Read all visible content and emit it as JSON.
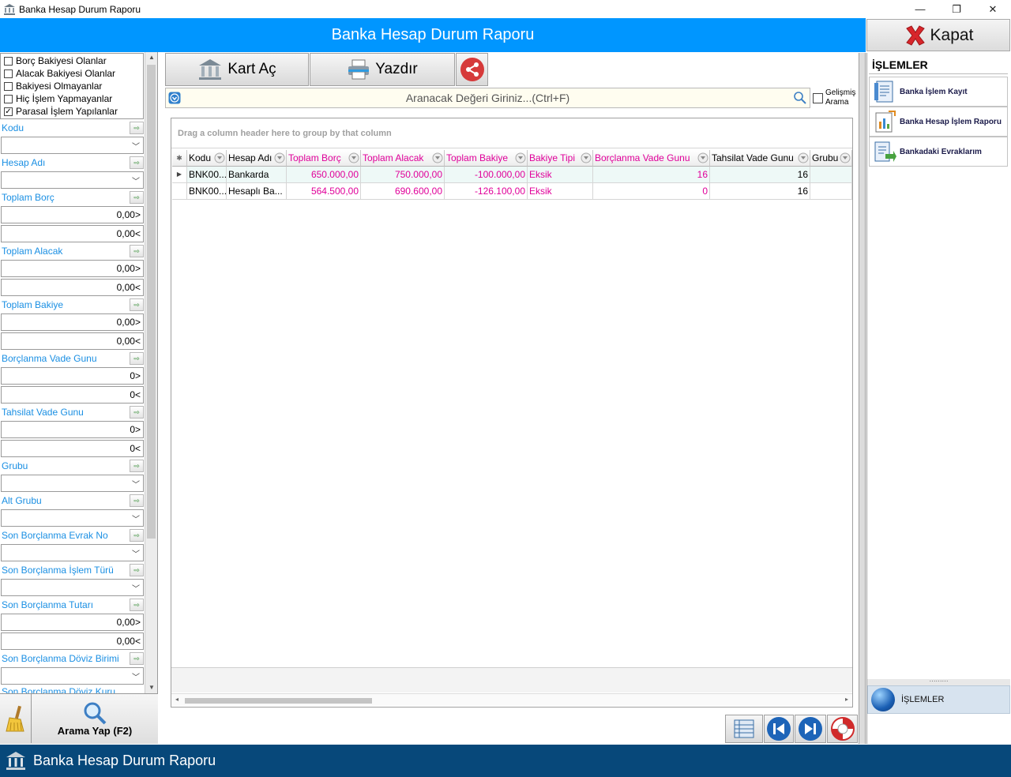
{
  "window": {
    "title": "Banka Hesap Durum Raporu",
    "controls": [
      "—",
      "❐",
      "✕"
    ]
  },
  "header": {
    "title": "Banka Hesap Durum Raporu",
    "close_label": "Kapat"
  },
  "filters": {
    "checkboxes": [
      {
        "label": "Borç Bakiyesi Olanlar",
        "checked": false
      },
      {
        "label": "Alacak Bakiyesi Olanlar",
        "checked": false
      },
      {
        "label": "Bakiyesi Olmayanlar",
        "checked": false
      },
      {
        "label": "Hiç İşlem Yapmayanlar",
        "checked": false
      },
      {
        "label": "Parasal İşlem Yapılanlar",
        "checked": true
      }
    ],
    "fields": {
      "kodu": "Kodu",
      "hesap_adi": "Hesap Adı",
      "toplam_borc": "Toplam Borç",
      "toplam_alacak": "Toplam Alacak",
      "toplam_bakiye": "Toplam Bakiye",
      "borclanma_vade_gunu": "Borçlanma Vade Gunu",
      "tahsilat_vade_gunu": "Tahsilat Vade Gunu",
      "grubu": "Grubu",
      "alt_grubu": "Alt Grubu",
      "son_borclanma_evrak_no": "Son Borçlanma Evrak No",
      "son_borclanma_islem_turu": "Son Borçlanma İşlem Türü",
      "son_borclanma_tutari": "Son Borçlanma Tutarı",
      "son_borclanma_doviz_birimi": "Son Borçlanma Döviz Birimi",
      "son_borclanma_doviz_kuru": "Son Borçlanma Döviz Kuru"
    },
    "values": {
      "toplam_borc_min": "0,00>",
      "toplam_borc_max": "0,00<",
      "toplam_alacak_min": "0,00>",
      "toplam_alacak_max": "0,00<",
      "toplam_bakiye_min": "0,00>",
      "toplam_bakiye_max": "0,00<",
      "borc_vade_min": "0>",
      "borc_vade_max": "0<",
      "tahsilat_vade_min": "0>",
      "tahsilat_vade_max": "0<",
      "son_tutar_min": "0,00>",
      "son_tutar_max": "0,00<"
    },
    "search_button": "Arama Yap (F2)"
  },
  "toolbar": {
    "kart_ac": "Kart Aç",
    "yazdir": "Yazdır"
  },
  "search": {
    "placeholder": "Aranacak Değeri Giriniz...(Ctrl+F)",
    "advanced_label_1": "Gelişmiş",
    "advanced_label_2": "Arama"
  },
  "grid": {
    "group_hint": "Drag a column header here to group by that column",
    "columns": [
      "Kodu",
      "Hesap Adı",
      "Toplam Borç",
      "Toplam Alacak",
      "Toplam Bakiye",
      "Bakiye Tipi",
      "Borçlanma Vade Gunu",
      "Tahsilat Vade Gunu",
      "Grubu"
    ],
    "rows": [
      {
        "kodu": "BNK00...",
        "hesap_adi": "Bankarda",
        "toplam_borc": "650.000,00",
        "toplam_alacak": "750.000,00",
        "toplam_bakiye": "-100.000,00",
        "bakiye_tipi": "Eksik",
        "borc_vade": "16",
        "tahsilat_vade": "16",
        "grubu": ""
      },
      {
        "kodu": "BNK00...",
        "hesap_adi": "Hesaplı Ba...",
        "toplam_borc": "564.500,00",
        "toplam_alacak": "690.600,00",
        "toplam_bakiye": "-126.100,00",
        "bakiye_tipi": "Eksik",
        "borc_vade": "0",
        "tahsilat_vade": "16",
        "grubu": ""
      }
    ]
  },
  "right_panel": {
    "title": "İŞLEMLER",
    "items": [
      "Banka İşlem Kayıt",
      "Banka Hesap İşlem Raporu",
      "Bankadaki Evraklarım"
    ],
    "selected_group": "İŞLEMLER"
  },
  "status_bar": {
    "title": "Banka Hesap Durum Raporu"
  }
}
